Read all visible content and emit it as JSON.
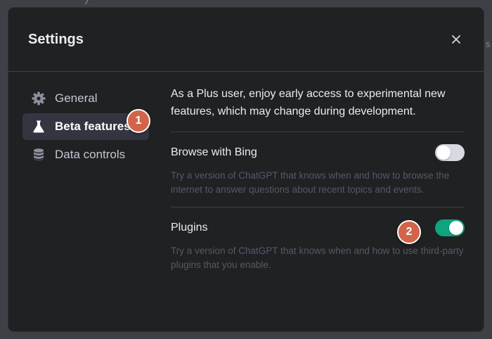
{
  "backdrop": {
    "top_text": "/**",
    "right_text": "s"
  },
  "dialog": {
    "title": "Settings",
    "close_icon": "close-icon"
  },
  "sidebar": {
    "items": [
      {
        "label": "General",
        "icon": "gear-icon",
        "active": false
      },
      {
        "label": "Beta features",
        "icon": "flask-icon",
        "active": true
      },
      {
        "label": "Data controls",
        "icon": "database-icon",
        "active": false
      }
    ]
  },
  "content": {
    "intro": "As a Plus user, enjoy early access to experimental new features, which may change during development.",
    "features": [
      {
        "name": "Browse with Bing",
        "description": "Try a version of ChatGPT that knows when and how to browse the internet to answer questions about recent topics and events.",
        "enabled": false
      },
      {
        "name": "Plugins",
        "description": "Try a version of ChatGPT that knows when and how to use third-party plugins that you enable.",
        "enabled": true
      }
    ]
  },
  "annotations": {
    "badge_1": "1",
    "badge_2": "2"
  },
  "colors": {
    "dialog_bg": "#202123",
    "active_item_bg": "#343541",
    "toggle_on": "#10a37f",
    "toggle_off": "#d9d9e3",
    "badge": "#d2644a"
  }
}
